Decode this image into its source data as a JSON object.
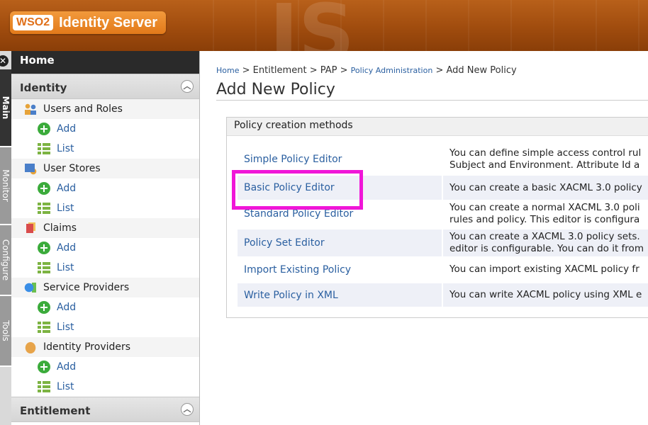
{
  "header": {
    "logo_mark": "WSO2",
    "product_name": "Identity Server"
  },
  "side_tabs": [
    {
      "label": "Main"
    },
    {
      "label": "Monitor"
    },
    {
      "label": "Configure"
    },
    {
      "label": "Tools"
    }
  ],
  "menu": {
    "home": "Home",
    "sections": [
      {
        "title": "Identity",
        "groups": [
          {
            "label": "Users and Roles",
            "icon": "users-roles-icon",
            "items": [
              "Add",
              "List"
            ]
          },
          {
            "label": "User Stores",
            "icon": "user-stores-icon",
            "items": [
              "Add",
              "List"
            ]
          },
          {
            "label": "Claims",
            "icon": "claims-icon",
            "items": [
              "Add",
              "List"
            ]
          },
          {
            "label": "Service Providers",
            "icon": "service-providers-icon",
            "items": [
              "Add",
              "List"
            ]
          },
          {
            "label": "Identity Providers",
            "icon": "identity-providers-icon",
            "items": [
              "Add",
              "List"
            ]
          }
        ]
      },
      {
        "title": "Entitlement"
      }
    ]
  },
  "breadcrumb": {
    "home": "Home",
    "entitlement": "Entitlement",
    "pap": "PAP",
    "policy_admin": "Policy Administration",
    "current": "Add New Policy",
    "separator": ">"
  },
  "page_title": "Add New Policy",
  "panel": {
    "title": "Policy creation methods",
    "rows": [
      {
        "name": "Simple Policy Editor",
        "desc_lines": [
          "You can define simple access control rul",
          "Subject and Environment. Attribute Id a"
        ]
      },
      {
        "name": "Basic Policy Editor",
        "desc_lines": [
          "You can create a basic XACML 3.0 policy"
        ]
      },
      {
        "name": "Standard Policy Editor",
        "desc_lines": [
          "You can create a normal XACML 3.0 poli",
          "rules and policy. This editor is configura"
        ]
      },
      {
        "name": "Policy Set Editor",
        "desc_lines": [
          "You can create a XACML 3.0 policy sets.",
          "editor is configurable. You can do it from"
        ]
      },
      {
        "name": "Import Existing Policy",
        "desc_lines": [
          "You can import existing XACML policy fr"
        ]
      },
      {
        "name": "Write Policy in XML",
        "desc_lines": [
          "You can write XACML policy using XML e"
        ]
      }
    ]
  },
  "colors": {
    "header_orange": "#a04c0e",
    "link_blue": "#2a5fa0",
    "highlight_magenta": "#f016d8",
    "row_shade": "#eef0f7"
  }
}
